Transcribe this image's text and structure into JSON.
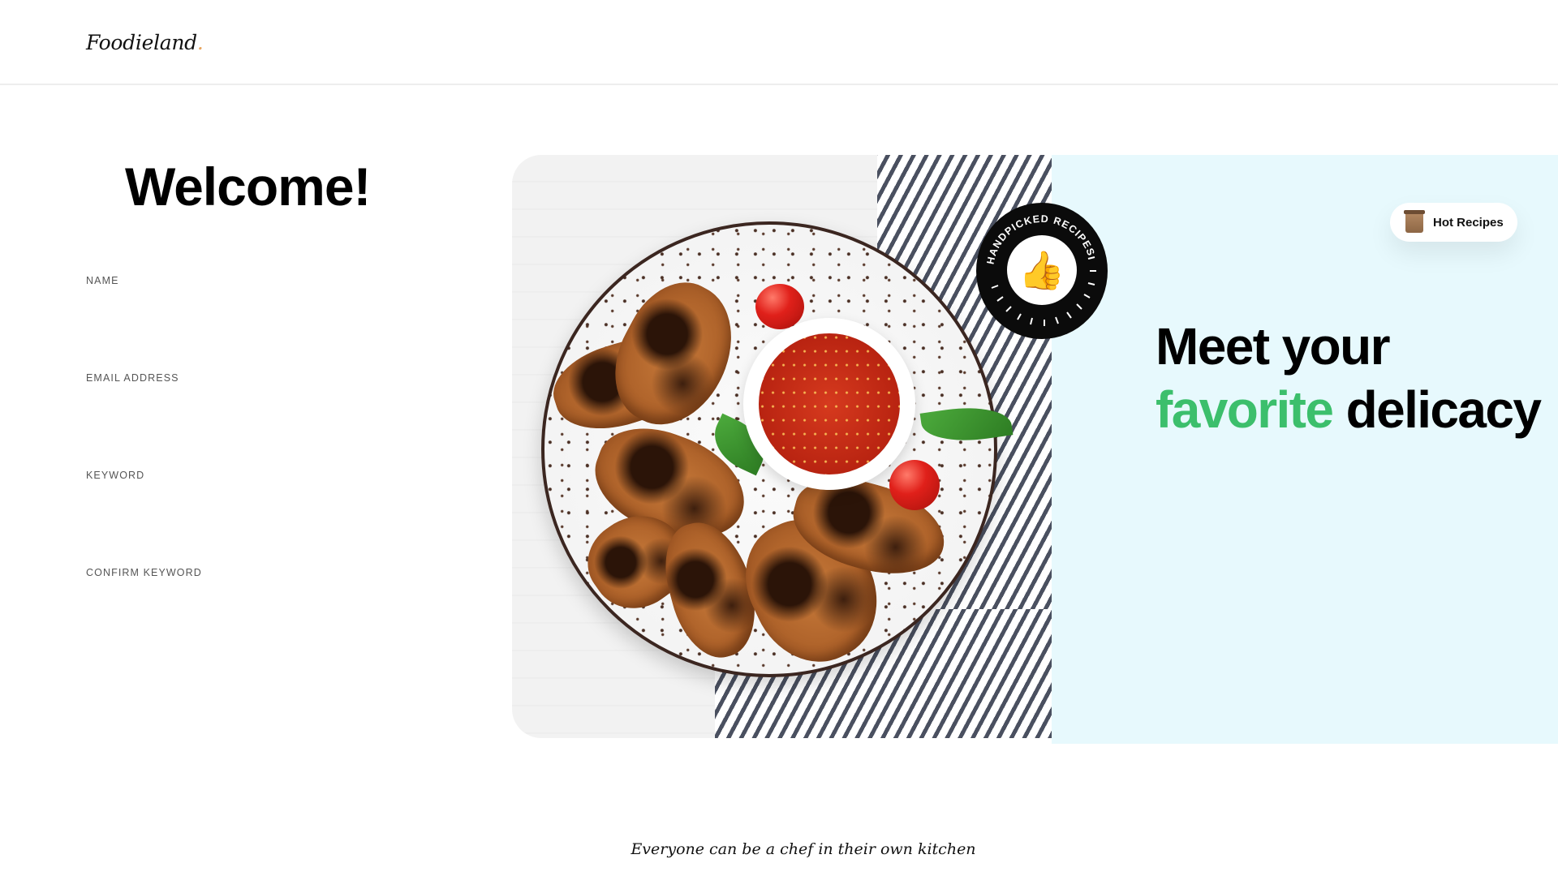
{
  "header": {
    "logo": "Foodieland",
    "logo_dot": "."
  },
  "form": {
    "title": "Welcome!",
    "fields": [
      {
        "label": "NAME",
        "value": ""
      },
      {
        "label": "EMAIL ADDRESS",
        "value": ""
      },
      {
        "label": "KEYWORD",
        "value": ""
      },
      {
        "label": "CONFIRM KEYWORD",
        "value": ""
      }
    ]
  },
  "hero": {
    "badge_text": "HANDPICKED RECIPES",
    "badge_icon": "thumbs-up-icon",
    "chip_icon": "recipe-bag-icon",
    "chip_label": "Hot Recipes",
    "headline_line1": "Meet your",
    "headline_accent": "favorite",
    "headline_rest": "delicacy",
    "colors": {
      "accent": "#3cbf6c",
      "panel_bg": "#e7f9fd"
    }
  },
  "footer": {
    "tagline": "Everyone can be a chef in their own kitchen"
  }
}
